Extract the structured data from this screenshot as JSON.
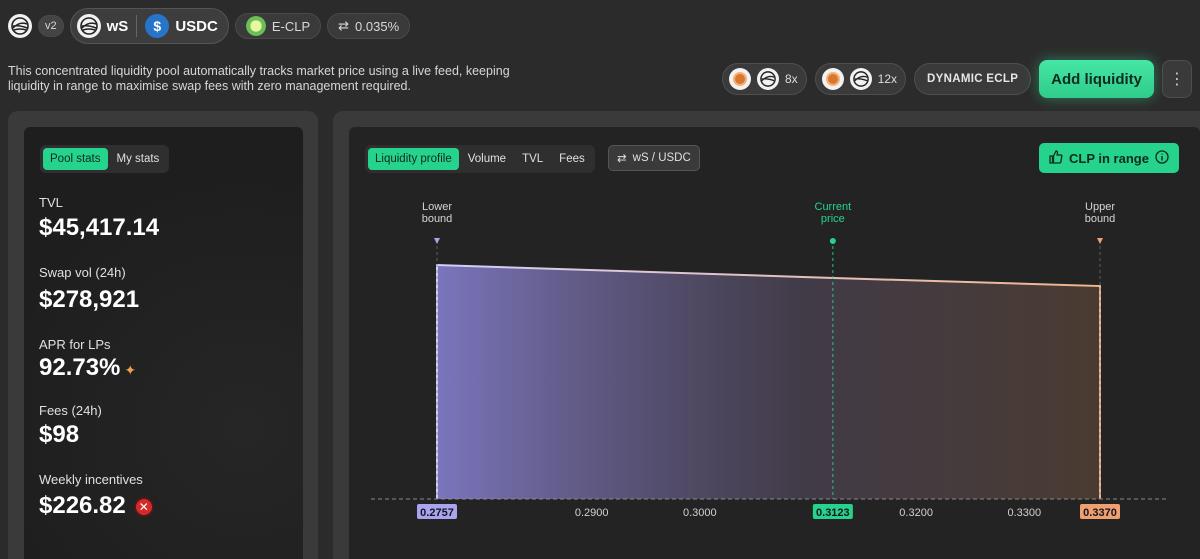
{
  "header": {
    "version_badge": "v2",
    "token_a": "wS",
    "token_b": "USDC",
    "pool_type": "E-CLP",
    "fee": "0.035%",
    "icons": {
      "brand_logo": "sonic-logo-icon",
      "token_a": "sonic-ws-token-icon",
      "token_b": "usdc-token-icon",
      "pool_type": "eclp-icon",
      "fee": "swap-arrows-icon"
    }
  },
  "description": "This concentrated liquidity pool automatically tracks market price using a live feed, keeping liquidity in range to maximise swap fees with zero management required.",
  "actions": {
    "boost_1": "8x",
    "boost_2": "12x",
    "tag": "DYNAMIC ECLP",
    "add_liquidity": "Add liquidity",
    "more": "⋮"
  },
  "stats_panel": {
    "tabs": [
      "Pool stats",
      "My stats"
    ],
    "active_tab": 0,
    "tvl_label": "TVL",
    "tvl_value": "$45,417.14",
    "swap_label": "Swap vol (24h)",
    "swap_value": "$278,921",
    "apr_label": "APR for LPs",
    "apr_value": "92.73%",
    "fees_label": "Fees (24h)",
    "fees_value": "$98",
    "incentives_label": "Weekly incentives",
    "incentives_value": "$226.82"
  },
  "chart_panel": {
    "tabs": [
      "Liquidity profile",
      "Volume",
      "TVL",
      "Fees"
    ],
    "active_tab": 0,
    "pair_toggle": "wS / USDC",
    "range_status": "CLP in range",
    "colors": {
      "accent": "#25d38d",
      "lower": "#a9a4f0",
      "upper": "#f0a070",
      "current": "#25d38d"
    }
  },
  "chart_data": {
    "type": "area",
    "x": [
      0.2757,
      0.312,
      0.337
    ],
    "y": [
      1.0,
      0.945,
      0.91
    ],
    "xlim": [
      0.2757,
      0.337
    ],
    "ticks": [
      {
        "value": 0.2757,
        "label": "0.2757",
        "kind": "lower"
      },
      {
        "value": 0.29,
        "label": "0.2900",
        "kind": "plain"
      },
      {
        "value": 0.3,
        "label": "0.3000",
        "kind": "plain"
      },
      {
        "value": 0.3123,
        "label": "0.3123",
        "kind": "current"
      },
      {
        "value": 0.32,
        "label": "0.3200",
        "kind": "plain"
      },
      {
        "value": 0.33,
        "label": "0.3300",
        "kind": "plain"
      },
      {
        "value": 0.337,
        "label": "0.3370",
        "kind": "upper"
      }
    ],
    "markers": {
      "lower": {
        "value": 0.2757,
        "label_line1": "Lower",
        "label_line2": "bound"
      },
      "current": {
        "value": 0.3123,
        "label_line1": "Current",
        "label_line2": "price"
      },
      "upper": {
        "value": 0.337,
        "label_line1": "Upper",
        "label_line2": "bound"
      }
    }
  }
}
